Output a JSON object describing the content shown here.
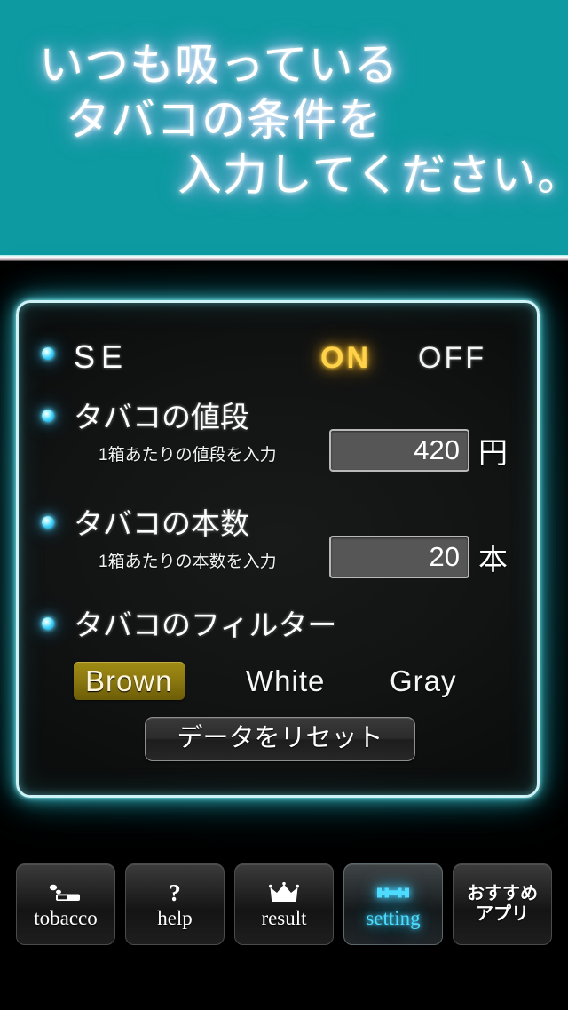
{
  "header": {
    "line1": "いつも吸っている",
    "line2": "タバコの条件を",
    "line3": "入力してください。",
    "bg_color": "#0d9aa0"
  },
  "panel": {
    "border_color": "#cdf3f7",
    "glow_color": "#3cd2dc",
    "rows": {
      "se": {
        "label": "SE",
        "on_label": "ON",
        "off_label": "OFF",
        "selected": "ON",
        "on_color": "#ffd24a"
      },
      "price": {
        "label": "タバコの値段",
        "sub_label": "1箱あたりの値段を入力",
        "value": "420",
        "unit": "円"
      },
      "count": {
        "label": "タバコの本数",
        "sub_label": "1箱あたりの本数を入力",
        "value": "20",
        "unit": "本"
      },
      "filter": {
        "label": "タバコのフィルター",
        "options": [
          "Brown",
          "White",
          "Gray"
        ],
        "selected": "Brown",
        "selected_color": "#8d7a10"
      }
    },
    "reset_button": {
      "label": "データをリセット"
    }
  },
  "tabbar": {
    "tabs": [
      {
        "label": "tobacco",
        "icon": "cigarette-icon",
        "active": false
      },
      {
        "label": "help",
        "icon": "question-mark-icon",
        "active": false
      },
      {
        "label": "result",
        "icon": "crown-icon",
        "active": false
      },
      {
        "label": "setting",
        "icon": "wrench-icon",
        "active": true
      },
      {
        "label_line1": "おすすめ",
        "label_line2": "アプリ",
        "icon": "none",
        "active": false
      }
    ],
    "active_color": "#4ddcff"
  }
}
